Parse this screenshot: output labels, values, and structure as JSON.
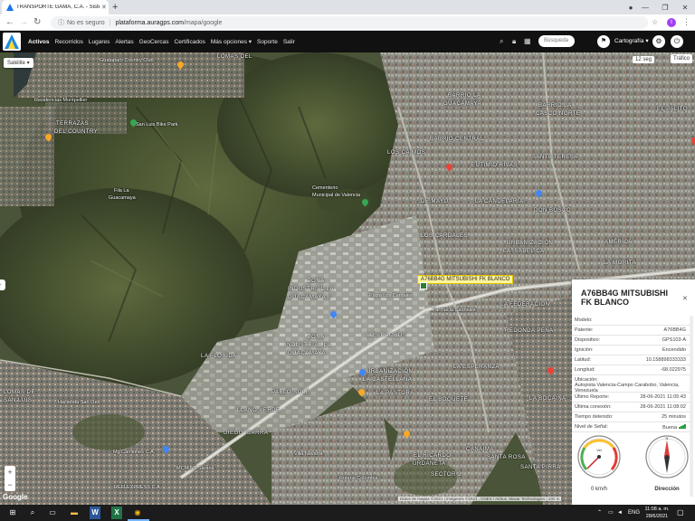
{
  "browser": {
    "tab_title": "TRANSPORTE GAMA, C.A. - Siste",
    "security_label": "No es seguro",
    "url_domain": "plataforma.auragps.com",
    "url_path": "/mapa/google",
    "profile_initial": "I"
  },
  "app": {
    "nav": [
      {
        "label": "Activos",
        "active": true
      },
      {
        "label": "Recorridos"
      },
      {
        "label": "Lugares"
      },
      {
        "label": "Alertas"
      },
      {
        "label": "GeoCercas"
      },
      {
        "label": "Certificados"
      },
      {
        "label": "Más opciones ▾"
      },
      {
        "label": "Soporte"
      },
      {
        "label": "Salir"
      }
    ],
    "search_placeholder": "Búsqueda",
    "map_style": "Cartografía"
  },
  "map": {
    "type_button": "Satélite",
    "refresh": "12 seg",
    "traffic": "Tráfico",
    "vehicle_label": "A76BB4G MITSUBISHI FK BLANCO",
    "attribution": "Datos de mapas ©2021 | Imágenes ©2021 , CNES / Airbus, Maxar Technologies | 200 m",
    "google": "Google",
    "labels": {
      "l1": "Guataparo Country Club",
      "l2": "LOMAS DEL",
      "l3": "Residencias Montpellier",
      "l4": "San Luis Bike Park",
      "l5": "TERRAZAS",
      "l6": "DEL COUNTRY",
      "l7": "Fila La",
      "l8": "Guacamaya",
      "l9": "BARRIO LA",
      "l10": "GUACAMAYA",
      "l11": "BARRIO LA",
      "l12": "CASCO NORTE",
      "l13": "EL PALITO",
      "l14": "BARRIO CENTRAL",
      "l15": "LOS CAIMOS",
      "l16": "EUTIMIO RIVAS",
      "l17": "SANTA TERESA",
      "l18": "Cementerio",
      "l19": "Municipal de Valencia",
      "l20": "DE MAYO",
      "l21": "LA CANDELARIA",
      "l22": "DON BOSCO",
      "l23": "LOS CARDALES",
      "l24": "URBANIZACIÓN",
      "l25": "LA ISABELICA",
      "l26": "AMÉRICA",
      "l27": "LA MORITA",
      "l28": "ZONA",
      "l29": "INDUSTRIAL LA",
      "l30": "GUACAMAYA II",
      "l31": "Plaza Los Cardales",
      "l32": "Farmacia Cabriales",
      "l33": "LA FEDERACIÓN",
      "l34": "REDONDA PEÑA",
      "l35": "ZONA",
      "l36": "INDUSTRIAL LA",
      "l37": "GUACAMAYA",
      "l38": "LOS CAOBOS",
      "l39": "LA FLORIDA",
      "l40": "URBANIZACIÓN",
      "l41": "LA CASTELLANA",
      "l42": "LA ESPERANZA",
      "l43": "LOMAS DE",
      "l44": "SAN LUIS",
      "l45": "Hacienda San Luis",
      "l46": "PABLO SOLÉ",
      "l47": "LA PASTORA",
      "l48": "EL BOQUETE",
      "l49": "LA BOCAINA",
      "l50": "LLANO VERDE",
      "l51": "DIEGO IBARRA",
      "l52": "Mg Camiones C.A.",
      "l53": "MCMINS Sarana",
      "l54": "Villa Navarra",
      "l55": "EL RICARDO",
      "l56": "URDANETA",
      "l57": "SECTOR 3",
      "l58": "CANAIMA",
      "l59": "SANTA ROSA",
      "l60": "SANTA PIRRA",
      "l61": "REFLEXPRESS C.A.",
      "l62": "Rotaria Colombia"
    }
  },
  "panel": {
    "title": "A76BB4G MITSUBISHI FK BLANCO",
    "rows": [
      {
        "label": "Modelo:",
        "value": ""
      },
      {
        "label": "Patente:",
        "value": "A76BB4G"
      },
      {
        "label": "Dispositivo:",
        "value": "GPS103-A"
      },
      {
        "label": "Ignición:",
        "value": "Encendido"
      },
      {
        "label": "Latitud:",
        "value": "10.158898333333"
      },
      {
        "label": "Longitud:",
        "value": "-68.022975"
      },
      {
        "label": "Ubicación:",
        "value": "Autopista Valencia-Campo Carabobo, Valencia, Venezuela"
      },
      {
        "label": "Último Reporte:",
        "value": "28-06-2021 11:05:43"
      },
      {
        "label": "Última conexión:",
        "value": "28-06-2021 11:08:02"
      },
      {
        "label": "Tiempo detenido:",
        "value": "25 minutos"
      },
      {
        "label": "Nivel de Señal:",
        "value": "Buena"
      }
    ],
    "speed_caption": "0 km/h",
    "direction_caption": "Dirección",
    "speed_value_kmh": 0
  },
  "taskbar": {
    "lang": "ENG",
    "time": "11:08 a. m.",
    "date": "28/6/2021"
  }
}
